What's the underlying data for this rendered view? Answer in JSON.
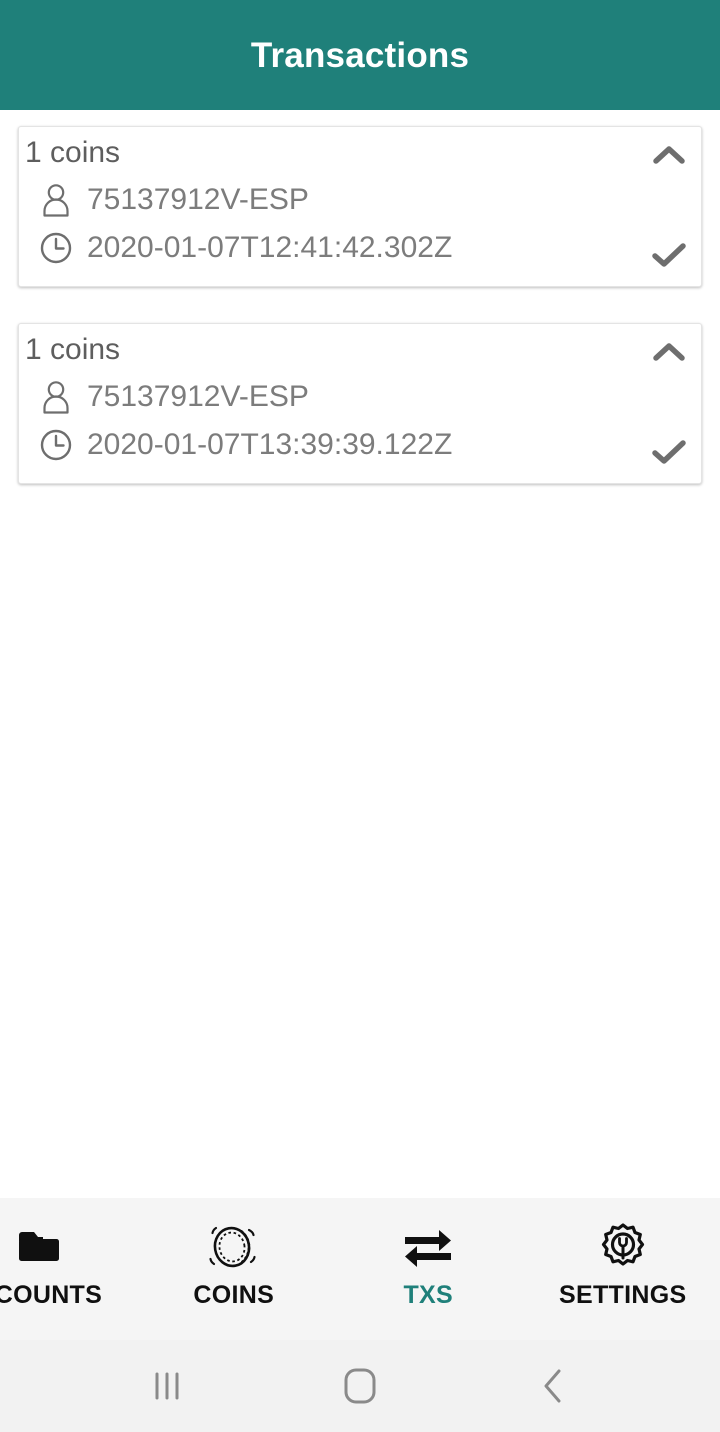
{
  "appbar": {
    "title": "Transactions",
    "background": "#1F807A",
    "text_color": "#FFFFFF"
  },
  "transactions": [
    {
      "amount_label": "1 coins",
      "account_id": "75137912V-ESP",
      "timestamp": "2020-01-07T12:41:42.302Z",
      "account_icon": "person-icon",
      "time_icon": "clock-icon",
      "collapse_icon": "chevron-up-icon",
      "status_icon": "check-icon"
    },
    {
      "amount_label": "1 coins",
      "account_id": "75137912V-ESP",
      "timestamp": "2020-01-07T13:39:39.122Z",
      "account_icon": "person-icon",
      "time_icon": "clock-icon",
      "collapse_icon": "chevron-up-icon",
      "status_icon": "check-icon"
    }
  ],
  "tabbar": {
    "background": "#F5F5F5",
    "active_color": "#1F807A",
    "inactive_color": "#101010",
    "tabs": [
      {
        "label": "CCOUNTS",
        "icon": "folder-icon",
        "active": false
      },
      {
        "label": "COINS",
        "icon": "coin-icon",
        "active": false
      },
      {
        "label": "TXS",
        "icon": "swap-arrows-icon",
        "active": true
      },
      {
        "label": "SETTINGS",
        "icon": "gear-wrench-icon",
        "active": false
      }
    ]
  },
  "system_nav": {
    "background": "#F2F2F2",
    "buttons": [
      {
        "name": "recents-button",
        "icon": "recents-icon"
      },
      {
        "name": "home-button",
        "icon": "home-icon"
      },
      {
        "name": "back-button",
        "icon": "back-chevron-icon"
      }
    ]
  }
}
